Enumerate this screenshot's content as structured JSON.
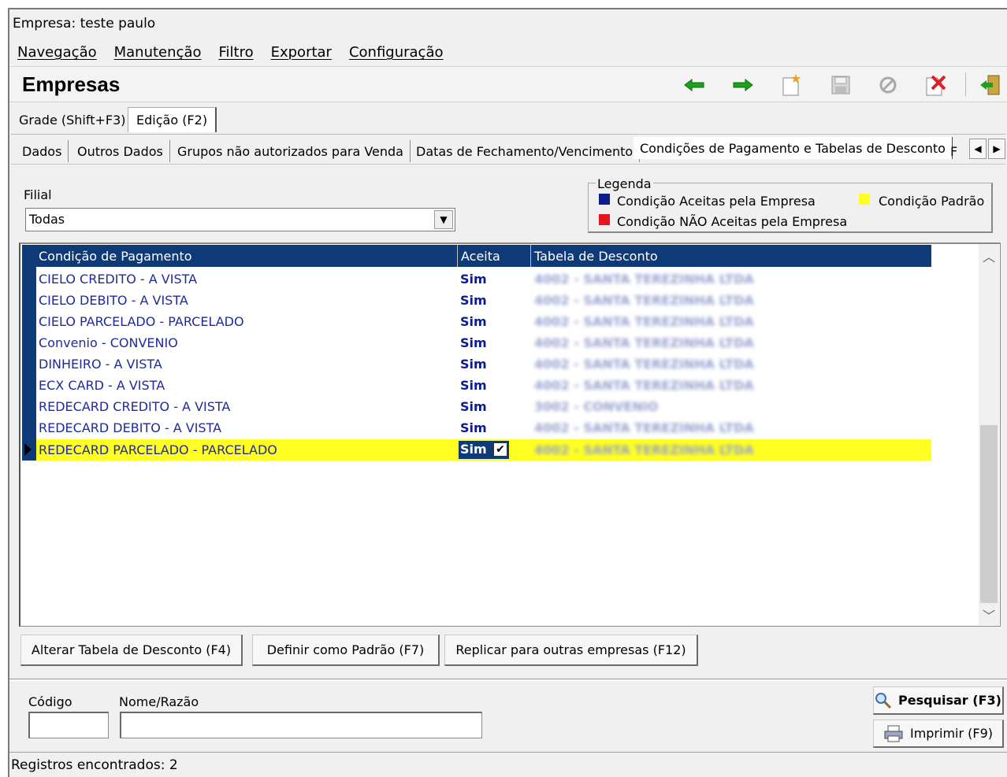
{
  "window": {
    "company_line": "Empresa: teste paulo"
  },
  "menu": [
    "Navegação",
    "Manutenção",
    "Filtro",
    "Exportar",
    "Configuração"
  ],
  "header": {
    "title": "Empresas"
  },
  "toolbar": {
    "icons": [
      "arrow-left-icon",
      "arrow-right-icon",
      "new-record-icon",
      "save-icon",
      "cancel-icon",
      "delete-icon",
      "exit-icon"
    ],
    "colors": {
      "arrows": "#1aa21a",
      "delete": "#e02020",
      "new": "#f0a020"
    }
  },
  "outer_tabs": [
    "Grade (Shift+F3)",
    "Edição (F2)"
  ],
  "inner_tabs": [
    "Dados",
    "Outros Dados",
    "Grupos não autorizados para Venda",
    "Datas de Fechamento/Vencimento",
    "Condições de Pagamento e Tabelas de Desconto",
    "F"
  ],
  "filial": {
    "label": "Filial",
    "value": "Todas"
  },
  "legend": {
    "title": "Legenda",
    "accepted": "Condição Aceitas pela Empresa",
    "not_accepted": "Condição NÃO Aceitas pela Empresa",
    "default": "Condição Padrão",
    "colors": {
      "accepted": "#0d1f8c",
      "not_accepted": "#e8141e",
      "default": "#ffff22"
    }
  },
  "grid": {
    "columns": [
      "Condição de Pagamento",
      "Aceita",
      "Tabela de Desconto"
    ],
    "rows": [
      {
        "cond": "CIELO CREDITO - A VISTA",
        "aceita": "Sim",
        "tabela": "4002 - SANTA TEREZINHA LTDA"
      },
      {
        "cond": "CIELO DEBITO - A VISTA",
        "aceita": "Sim",
        "tabela": "4002 - SANTA TEREZINHA LTDA"
      },
      {
        "cond": "CIELO PARCELADO - PARCELADO",
        "aceita": "Sim",
        "tabela": "4002 - SANTA TEREZINHA LTDA"
      },
      {
        "cond": "Convenio - CONVENIO",
        "aceita": "Sim",
        "tabela": "4002 - SANTA TEREZINHA LTDA"
      },
      {
        "cond": "DINHEIRO - A VISTA",
        "aceita": "Sim",
        "tabela": "4002 - SANTA TEREZINHA LTDA"
      },
      {
        "cond": "ECX CARD - A VISTA",
        "aceita": "Sim",
        "tabela": "4002 - SANTA TEREZINHA LTDA"
      },
      {
        "cond": "REDECARD CREDITO - A VISTA",
        "aceita": "Sim",
        "tabela": "3002 - CONVENIO"
      },
      {
        "cond": "REDECARD DEBITO - A VISTA",
        "aceita": "Sim",
        "tabela": "4002 - SANTA TEREZINHA LTDA"
      },
      {
        "cond": "REDECARD PARCELADO - PARCELADO",
        "aceita": "Sim",
        "tabela": "4002 - SANTA TEREZINHA LTDA"
      }
    ],
    "check_glyph": "✔"
  },
  "buttons": {
    "alterar": "Alterar Tabela de Desconto (F4)",
    "definir": "Definir como Padrão (F7)",
    "replicar": "Replicar para outras empresas (F12)"
  },
  "search": {
    "codigo_label": "Código",
    "nome_label": "Nome/Razão",
    "pesquisar": "Pesquisar (F3)",
    "imprimir": "Imprimir (F9)"
  },
  "status": "Registros encontrados: 2"
}
